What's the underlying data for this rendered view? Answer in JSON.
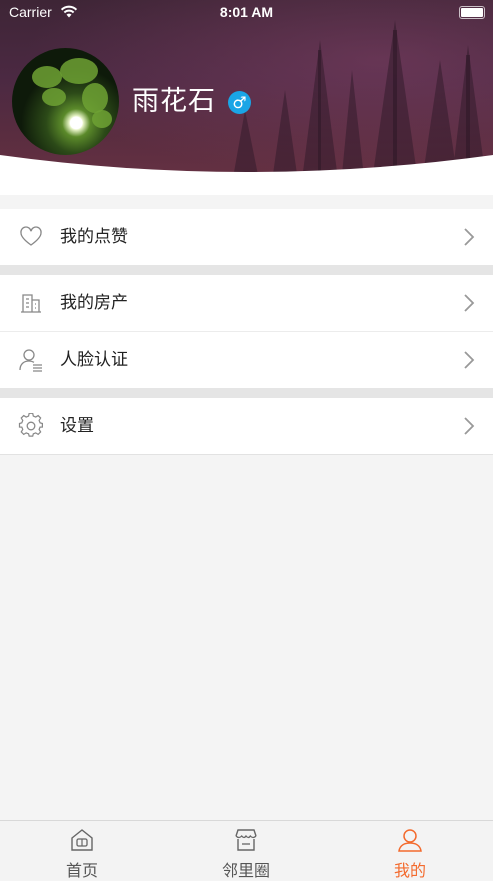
{
  "status_bar": {
    "carrier": "Carrier",
    "time": "8:01 AM"
  },
  "profile": {
    "name": "雨花石",
    "gender_symbol": "♂"
  },
  "menu": {
    "group1": [
      {
        "label": "我的点赞",
        "icon": "heart-icon"
      }
    ],
    "group2": [
      {
        "label": "我的房产",
        "icon": "building-icon"
      },
      {
        "label": "人脸认证",
        "icon": "person-id-icon"
      }
    ],
    "group3": [
      {
        "label": "设置",
        "icon": "gear-icon"
      }
    ]
  },
  "tabbar": {
    "active_color": "#f36a2d",
    "tabs": [
      {
        "label": "首页",
        "icon": "home-icon",
        "active": false
      },
      {
        "label": "邻里圈",
        "icon": "shop-icon",
        "active": false
      },
      {
        "label": "我的",
        "icon": "user-icon",
        "active": true
      }
    ]
  }
}
